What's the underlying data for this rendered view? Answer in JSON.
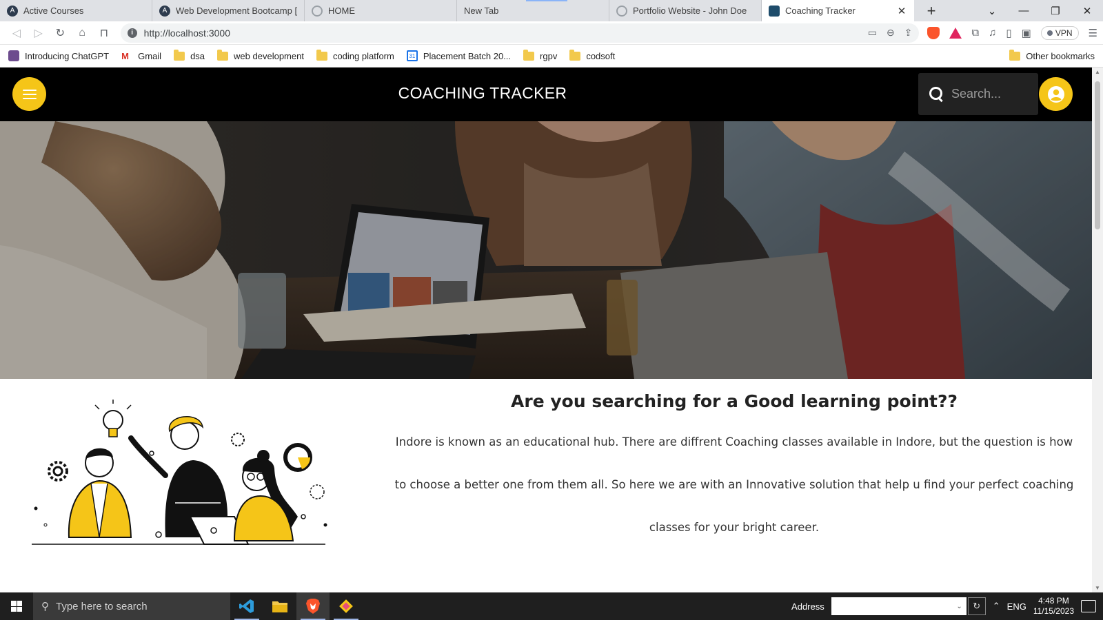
{
  "browser": {
    "tabs": [
      {
        "label": "Active Courses",
        "active": false
      },
      {
        "label": "Web Development Bootcamp [MER",
        "active": false
      },
      {
        "label": "HOME",
        "active": false
      },
      {
        "label": "New Tab",
        "active": false
      },
      {
        "label": "Portfolio Website - John Doe",
        "active": false
      },
      {
        "label": "Coaching Tracker",
        "active": true
      }
    ],
    "new_tab_label": "+",
    "url": "http://localhost:3000",
    "vpn_label": "VPN",
    "bookmarks": [
      {
        "label": "Introducing ChatGPT",
        "icon": "chatgpt-icon"
      },
      {
        "label": "Gmail",
        "icon": "gmail-icon"
      },
      {
        "label": "dsa",
        "icon": "folder-icon"
      },
      {
        "label": "web development",
        "icon": "folder-icon"
      },
      {
        "label": "coding platform",
        "icon": "folder-icon"
      },
      {
        "label": "Placement Batch 20...",
        "icon": "calendar-icon"
      },
      {
        "label": "rgpv",
        "icon": "folder-icon"
      },
      {
        "label": "codsoft",
        "icon": "folder-icon"
      }
    ],
    "other_bookmarks": "Other bookmarks"
  },
  "site": {
    "title": "COACHING TRACKER",
    "search_placeholder": "Search...",
    "accent_color": "#f5c518",
    "about": {
      "heading": "Are you searching for a Good learning point??",
      "body": "Indore is known as an educational hub. There are diffrent Coaching classes available in Indore, but the question is how to choose a better one from them all. So here we are with an Innovative solution that help u find your perfect coaching classes for your bright career."
    }
  },
  "taskbar": {
    "search_placeholder": "Type here to search",
    "address_label": "Address",
    "language": "ENG",
    "time": "4:48 PM",
    "date": "11/15/2023"
  }
}
